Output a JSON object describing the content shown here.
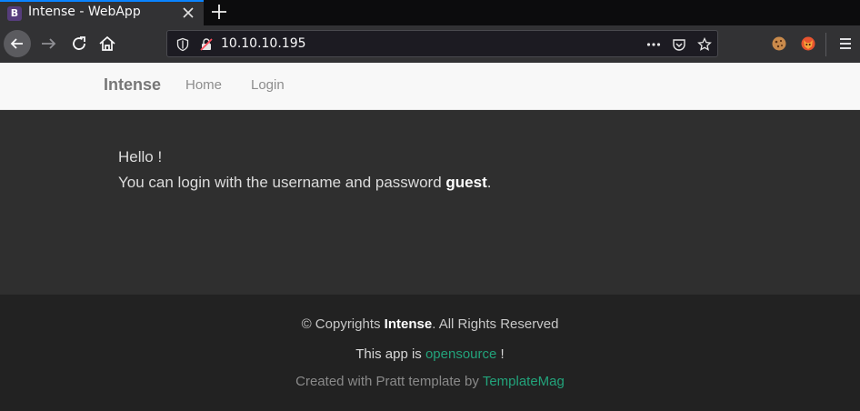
{
  "browser": {
    "tab": {
      "favicon_letter": "B",
      "title": "Intense - WebApp"
    },
    "url": "10.10.10.195",
    "icons": [
      "back-icon",
      "forward-icon",
      "reload-icon",
      "home-icon",
      "shield-icon",
      "insecure-lock-icon",
      "more-icon",
      "pocket-icon",
      "star-icon",
      "cookie-extension-icon",
      "fox-extension-icon",
      "menu-icon"
    ]
  },
  "site": {
    "brand": "Intense",
    "nav": [
      {
        "label": "Home"
      },
      {
        "label": "Login"
      }
    ]
  },
  "main": {
    "greeting": "Hello !",
    "login_prefix": "You can login with the username and password ",
    "login_credential": "guest",
    "login_suffix": "."
  },
  "footer": {
    "copyright_prefix": "© Copyrights ",
    "copyright_brand": "Intense",
    "copyright_suffix": ". All Rights Reserved",
    "opensource_prefix": "This app is ",
    "opensource_link": "opensource",
    "opensource_suffix": " !",
    "credit_prefix": "Created with Pratt template by ",
    "credit_link": "TemplateMag"
  },
  "colors": {
    "page_bg": "#2f2f2f",
    "footer_bg": "#222222",
    "link_green": "#22a37b"
  }
}
